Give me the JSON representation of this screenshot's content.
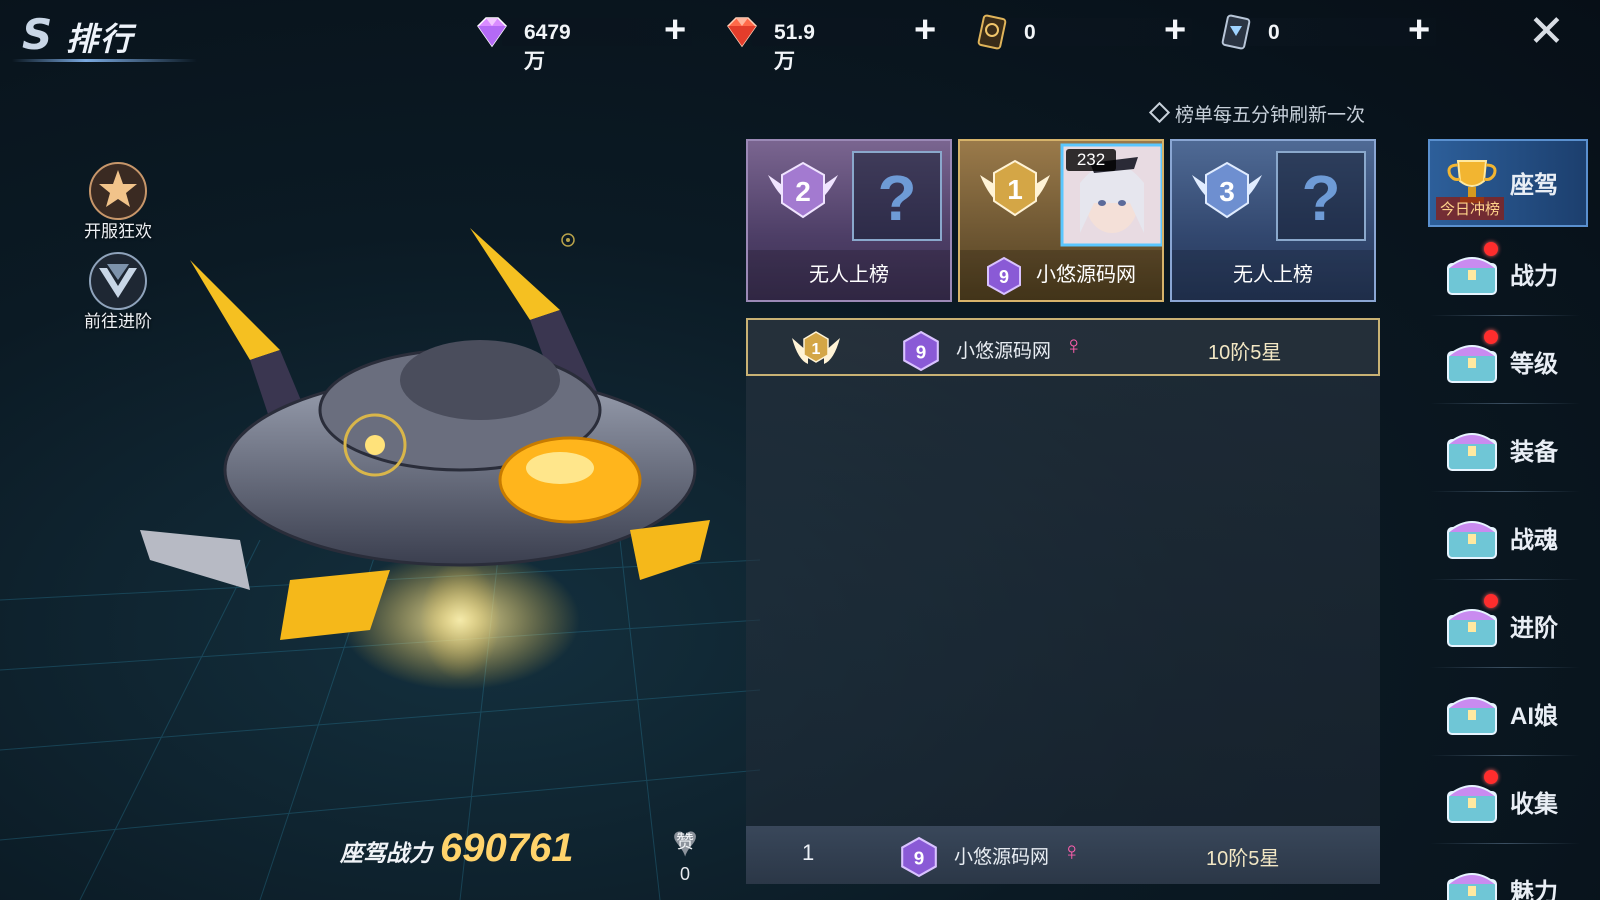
{
  "header": {
    "title": "排行",
    "currencies": [
      {
        "icon": "gem-icon",
        "value": "6479万"
      },
      {
        "icon": "red-gem-icon",
        "value": "51.9万"
      },
      {
        "icon": "gold-card-icon",
        "value": "0"
      },
      {
        "icon": "silver-card-icon",
        "value": "0"
      }
    ],
    "plus_label": "+",
    "close_label": "✕"
  },
  "notice": "榜单每五分钟刷新一次",
  "left_buttons": [
    {
      "label": "开服狂欢",
      "icon": "carnival-icon"
    },
    {
      "label": "前往进阶",
      "icon": "advance-icon"
    }
  ],
  "top_three": [
    {
      "rank": "2",
      "name": "无人上榜",
      "placeholder": "?"
    },
    {
      "rank": "1",
      "name": "小悠源码网",
      "level": "232",
      "vip": "9"
    },
    {
      "rank": "3",
      "name": "无人上榜",
      "placeholder": "?"
    }
  ],
  "list": {
    "rows": [
      {
        "rank": "1",
        "vip": "9",
        "name": "小悠源码网",
        "gender": "♀",
        "value": "10阶5星"
      }
    ],
    "mine": {
      "rank": "1",
      "vip": "9",
      "name": "小悠源码网",
      "gender": "♀",
      "value": "10阶5星"
    }
  },
  "categories": [
    {
      "label": "座驾",
      "sub": "今日冲榜",
      "active": true,
      "icon": "trophy-icon"
    },
    {
      "label": "战力",
      "dot": true,
      "icon": "chest-icon"
    },
    {
      "label": "等级",
      "dot": true,
      "icon": "chest-icon"
    },
    {
      "label": "装备",
      "dot": false,
      "icon": "chest-icon"
    },
    {
      "label": "战魂",
      "dot": false,
      "icon": "chest-icon"
    },
    {
      "label": "进阶",
      "dot": true,
      "icon": "chest-icon"
    },
    {
      "label": "AI娘",
      "dot": false,
      "icon": "chest-icon"
    },
    {
      "label": "收集",
      "dot": true,
      "icon": "chest-icon"
    },
    {
      "label": "魅力",
      "dot": false,
      "icon": "chest-icon"
    }
  ],
  "mount": {
    "power_label": "座驾战力",
    "power_value": "690761",
    "like_label": "赞",
    "like_count": "0"
  },
  "colors": {
    "accent_gold": "#ffd36b",
    "active_tab": "#2d5f9a",
    "female": "#ff5fae"
  }
}
